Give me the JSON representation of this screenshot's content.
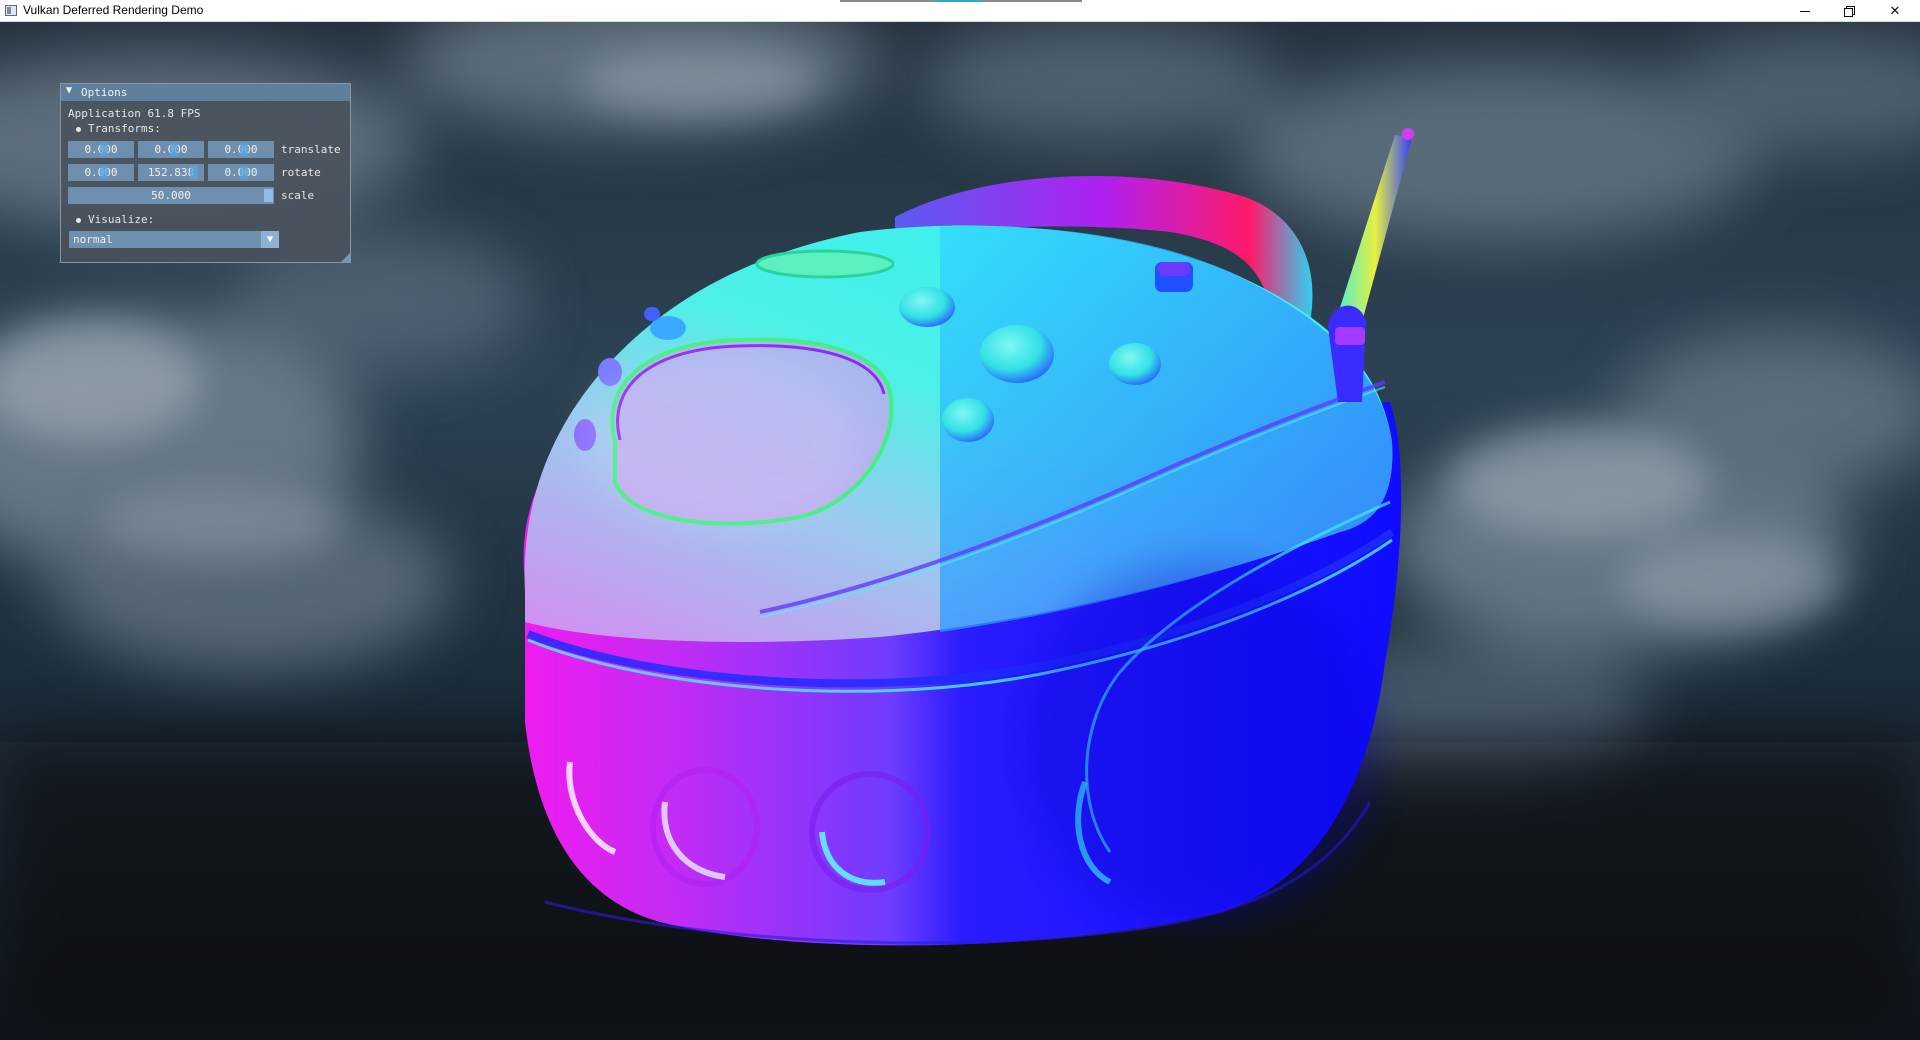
{
  "window": {
    "title": "Vulkan Deferred Rendering Demo",
    "controls": {
      "minimize": "minimize",
      "maximize": "restore",
      "close": "✕"
    }
  },
  "scene": {
    "description_icon": "3d-model-normal-visualization",
    "background": "cloudy-sky-skybox",
    "colors": {
      "sky_dark": "#16212c",
      "sky_mid": "#324a5e",
      "cloud": "#8a9aa8",
      "model_cyan": "#2fe6e6",
      "model_blue": "#1010ff",
      "model_magenta": "#e21ef2"
    }
  },
  "options": {
    "title": "Options",
    "collapse_icon": "▼",
    "fps_label": "Application 61.8 FPS",
    "transforms_label": "Transforms:",
    "translate": {
      "x": "0.000",
      "y": "0.000",
      "z": "0.000",
      "label": "translate"
    },
    "rotate": {
      "x": "0.000",
      "y": "152.838",
      "z": "0.000",
      "label": "rotate"
    },
    "scale": {
      "value": "50.000",
      "label": "scale"
    },
    "visualize_label": "Visualize:",
    "visualize_value": "normal",
    "combo_arrow": "▼"
  }
}
